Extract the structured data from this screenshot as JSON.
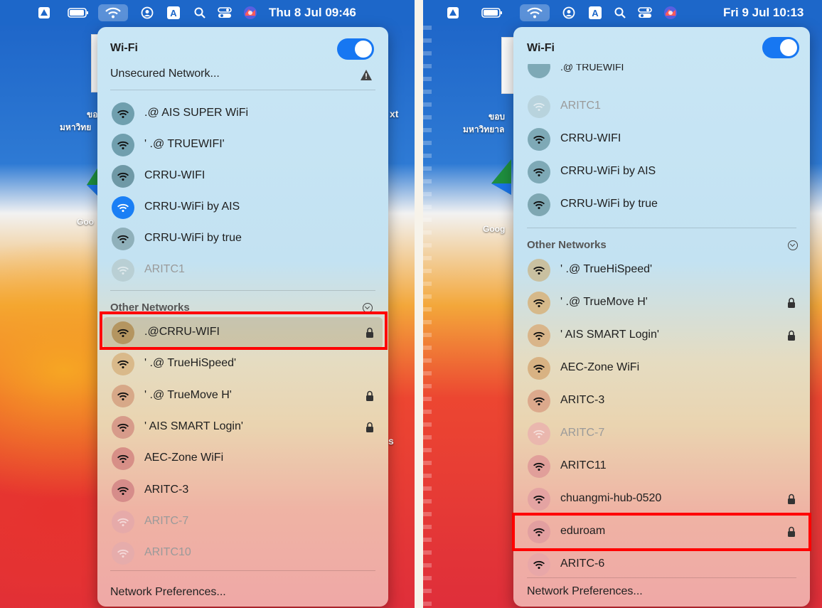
{
  "left": {
    "menubar": {
      "clock": "Thu 8 Jul 09:46"
    },
    "desktop": {
      "label1": "ขอ",
      "label2": "มหาวิทย",
      "label3": "xt",
      "label4": "Goo"
    },
    "menu": {
      "title": "Wi-Fi",
      "toggle_on": true,
      "unsecured": "Unsecured Network...",
      "known": [
        {
          "name": ".@ AIS SUPER WiFi",
          "lock": false,
          "dim": false,
          "selected": false,
          "circle": "#6f9fae"
        },
        {
          "name": "'  .@ TRUEWIFI'",
          "lock": false,
          "dim": false,
          "selected": false,
          "circle": "#709fae"
        },
        {
          "name": "CRRU-WIFI",
          "lock": false,
          "dim": false,
          "selected": false,
          "circle": "#6f99a6"
        },
        {
          "name": "CRRU-WiFi by AIS",
          "lock": false,
          "dim": false,
          "selected": true,
          "circle": "#1a7ff5"
        },
        {
          "name": "CRRU-WiFi by true",
          "lock": false,
          "dim": false,
          "selected": false,
          "circle": "#8fb0ba"
        },
        {
          "name": "ARITC1",
          "lock": false,
          "dim": true,
          "selected": false,
          "circle": "#b9cfd4"
        }
      ],
      "other_header": "Other Networks",
      "other": [
        {
          "name": ".@CRRU-WIFI",
          "lock": true,
          "dim": false,
          "selected": false,
          "circle": "#b49560"
        },
        {
          "name": "'  .@ TrueHiSpeed'",
          "lock": false,
          "dim": false,
          "selected": false,
          "circle": "#d9b98a"
        },
        {
          "name": "'  .@ TrueMove H'",
          "lock": true,
          "dim": false,
          "selected": false,
          "circle": "#d7a888"
        },
        {
          "name": "'  AIS SMART Login'",
          "lock": true,
          "dim": false,
          "selected": false,
          "circle": "#d79b8a"
        },
        {
          "name": "AEC-Zone WiFi",
          "lock": false,
          "dim": false,
          "selected": false,
          "circle": "#d78f87"
        },
        {
          "name": "ARITC-3",
          "lock": false,
          "dim": false,
          "selected": false,
          "circle": "#d68c8a"
        },
        {
          "name": "ARITC-7",
          "lock": false,
          "dim": true,
          "selected": false,
          "circle": "#e6aaa9"
        },
        {
          "name": "ARITC10",
          "lock": false,
          "dim": true,
          "selected": false,
          "circle": "#e6acab"
        }
      ],
      "footer": "Network Preferences..."
    }
  },
  "right": {
    "menubar": {
      "clock": "Fri 9 Jul 10:13"
    },
    "desktop": {
      "label1": "ขอบ",
      "label2": "มหาวิทยาล",
      "label3": "Goog"
    },
    "menu": {
      "title": "Wi-Fi",
      "toggle_on": true,
      "known_partial": ".@ TRUEWIFI",
      "known": [
        {
          "name": "ARITC1",
          "lock": false,
          "dim": true,
          "selected": false,
          "circle": "#b8d3dd"
        },
        {
          "name": "CRRU-WIFI",
          "lock": false,
          "dim": false,
          "selected": false,
          "circle": "#7ea9b6"
        },
        {
          "name": "CRRU-WiFi by AIS",
          "lock": false,
          "dim": false,
          "selected": false,
          "circle": "#7ea9b6"
        },
        {
          "name": "CRRU-WiFi by true",
          "lock": false,
          "dim": false,
          "selected": false,
          "circle": "#7ea7b2"
        }
      ],
      "other_header": "Other Networks",
      "other": [
        {
          "name": "'  .@ TrueHiSpeed'",
          "lock": false,
          "dim": false,
          "selected": false,
          "circle": "#c9c0a0"
        },
        {
          "name": "'  .@ TrueMove H'",
          "lock": true,
          "dim": false,
          "selected": false,
          "circle": "#d6b98a"
        },
        {
          "name": "'  AIS SMART Login'",
          "lock": true,
          "dim": false,
          "selected": false,
          "circle": "#d9b58a"
        },
        {
          "name": "AEC-Zone WiFi",
          "lock": false,
          "dim": false,
          "selected": false,
          "circle": "#d8b283"
        },
        {
          "name": "ARITC-3",
          "lock": false,
          "dim": false,
          "selected": false,
          "circle": "#dca98c"
        },
        {
          "name": "ARITC-7",
          "lock": false,
          "dim": true,
          "selected": false,
          "circle": "#eab7ae"
        },
        {
          "name": "ARITC11",
          "lock": false,
          "dim": false,
          "selected": false,
          "circle": "#e19f9a"
        },
        {
          "name": "chuangmi-hub-0520",
          "lock": true,
          "dim": false,
          "selected": false,
          "circle": "#e4a3a2"
        },
        {
          "name": "eduroam",
          "lock": true,
          "dim": false,
          "selected": false,
          "circle": "#e29fa0"
        },
        {
          "name": "ARITC-6",
          "lock": false,
          "dim": false,
          "selected": false,
          "circle": "#e8a7a8"
        }
      ],
      "footer": "Network Preferences..."
    }
  },
  "colors": {
    "menubar": "#1d67c9",
    "toggle": "#1777f2",
    "highlight": "#ff0000",
    "selected_wifi": "#1a7ff5"
  }
}
